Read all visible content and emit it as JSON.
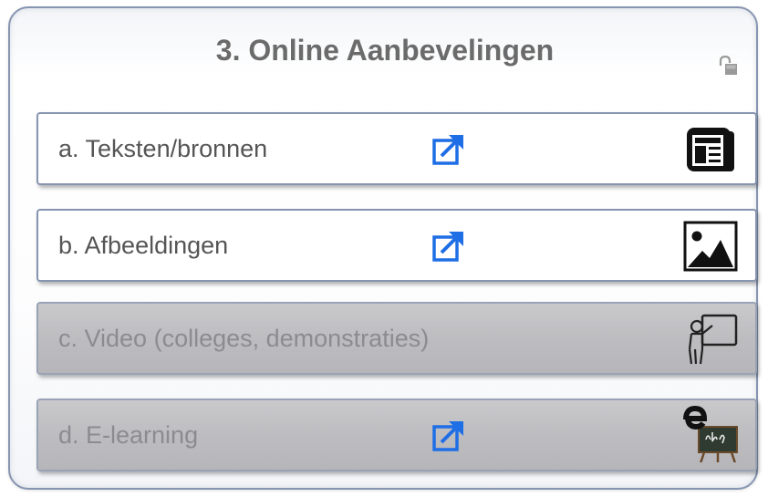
{
  "title": "3. Online Aanbevelingen",
  "lock_icon": "unlocked-padlock-icon",
  "items": [
    {
      "label": "a. Teksten/bronnen",
      "enabled": true,
      "has_link": true,
      "icon": "newspaper-icon"
    },
    {
      "label": "b. Afbeeldingen",
      "enabled": true,
      "has_link": true,
      "icon": "image-icon"
    },
    {
      "label": "c. Video (colleges, demonstraties)",
      "enabled": false,
      "has_link": false,
      "icon": "presenter-icon"
    },
    {
      "label": "d. E-learning",
      "enabled": false,
      "has_link": true,
      "icon": "e-learning-blackboard-icon"
    }
  ],
  "colors": {
    "accent_link": "#1e6ee6",
    "title_text": "#6b6b6b",
    "border": "#8795b0",
    "disabled_fill": "#bdbdc0"
  }
}
